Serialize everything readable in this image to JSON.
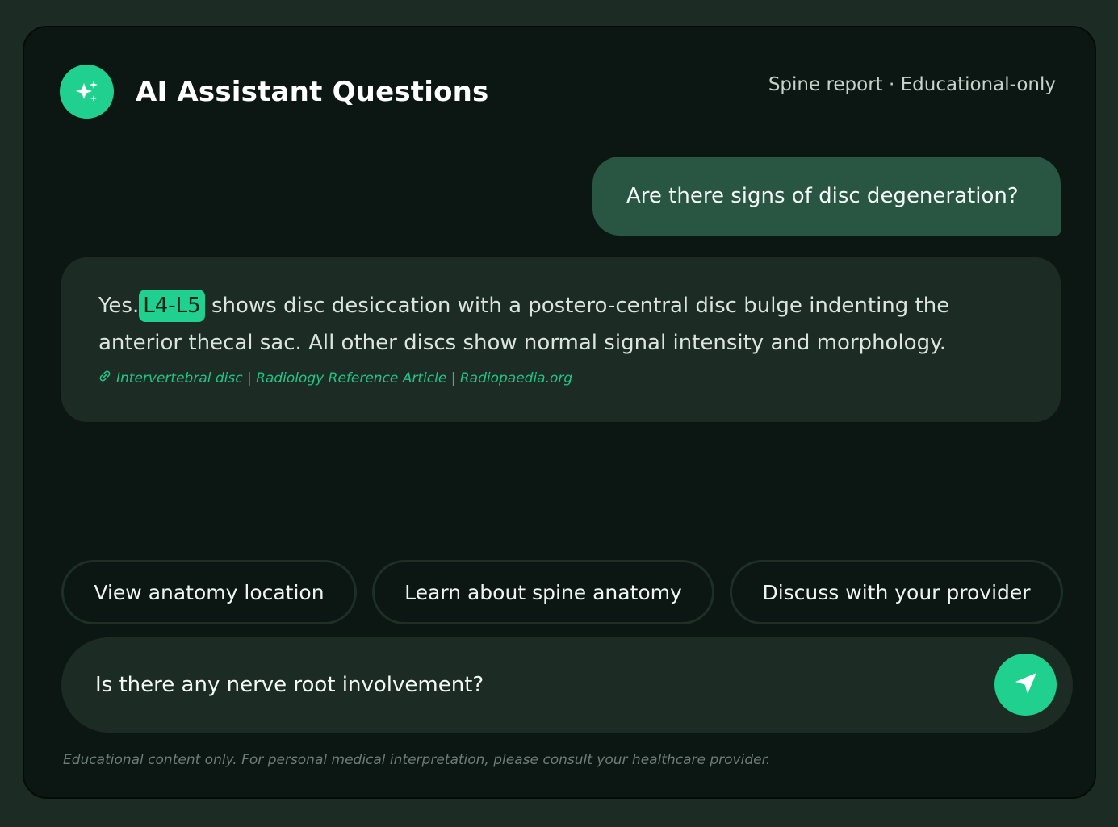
{
  "header": {
    "logo_icon": "sparkles-icon",
    "title": "AI Assistant Questions",
    "meta": "Spine report · Educational-only"
  },
  "conversation": {
    "user_message": "Are there signs of disc degeneration?",
    "assistant": {
      "text_before": "Yes.",
      "highlight": "L4-L5",
      "text_after": "shows disc desiccation with a postero-central disc bulge indenting the anterior thecal sac. All other discs show normal signal intensity and morphology.",
      "source_icon": "link-icon",
      "source": "Intervertebral disc | Radiology Reference Article | Radiopaedia.org"
    }
  },
  "suggestions": [
    {
      "label": "View anatomy location"
    },
    {
      "label": "Learn about spine anatomy"
    },
    {
      "label": "Discuss with your provider"
    }
  ],
  "composer": {
    "value": "Is there any nerve root involvement?",
    "send_icon": "send-icon"
  },
  "footer": {
    "disclaimer": "Educational content only. For personal medical interpretation, please consult your healthcare provider."
  },
  "colors": {
    "accent": "#1fd08f",
    "background": "#0c1713",
    "user_bubble": "#285642",
    "assistant_bubble": "#1c2c25"
  }
}
